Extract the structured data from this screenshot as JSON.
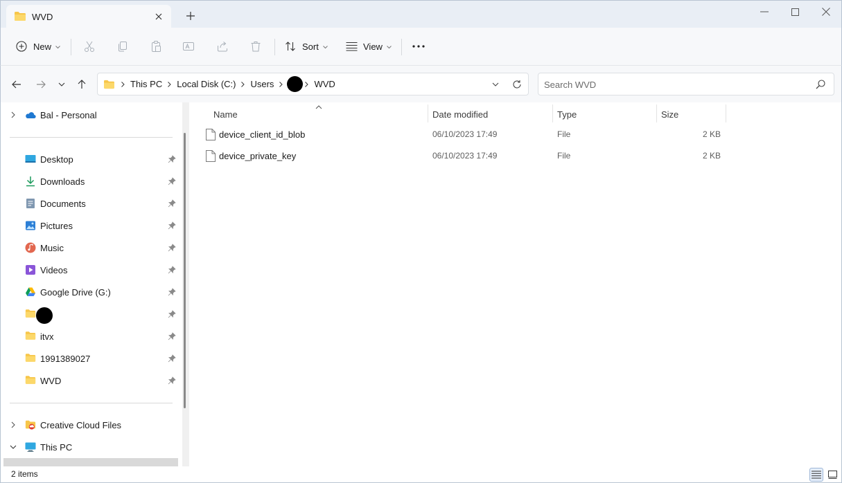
{
  "window": {
    "tab_title": "WVD",
    "minimize_icon": "minimize-icon",
    "maximize_icon": "maximize-icon",
    "close_icon": "close-icon"
  },
  "toolbar": {
    "new_label": "New",
    "sort_label": "Sort",
    "view_label": "View",
    "icons": [
      "cut-icon",
      "copy-icon",
      "paste-icon",
      "rename-icon",
      "share-icon",
      "delete-icon",
      "more-icon"
    ]
  },
  "address": {
    "crumbs": [
      "This PC",
      "Local Disk (C:)",
      "Users",
      "WVD"
    ],
    "redacted_crumb_index": 3
  },
  "search": {
    "placeholder": "Search WVD"
  },
  "sidebar": {
    "onedrive": "Bal - Personal",
    "quick_access": [
      {
        "label": "Desktop",
        "icon": "desktop-icon"
      },
      {
        "label": "Downloads",
        "icon": "download-icon"
      },
      {
        "label": "Documents",
        "icon": "documents-icon"
      },
      {
        "label": "Pictures",
        "icon": "pictures-icon"
      },
      {
        "label": "Music",
        "icon": "music-icon"
      },
      {
        "label": "Videos",
        "icon": "videos-icon"
      },
      {
        "label": "Google Drive (G:)",
        "icon": "google-drive-icon"
      },
      {
        "label": "",
        "icon": "folder-icon"
      },
      {
        "label": "itvx",
        "icon": "folder-icon"
      },
      {
        "label": "1991389027",
        "icon": "folder-icon"
      },
      {
        "label": "WVD",
        "icon": "folder-icon"
      }
    ],
    "creative_cloud": "Creative Cloud Files",
    "this_pc": "This PC"
  },
  "columns": {
    "name": "Name",
    "date": "Date modified",
    "type": "Type",
    "size": "Size"
  },
  "files": [
    {
      "name": "device_client_id_blob",
      "date": "06/10/2023 17:49",
      "type": "File",
      "size": "2 KB"
    },
    {
      "name": "device_private_key",
      "date": "06/10/2023 17:49",
      "type": "File",
      "size": "2 KB"
    }
  ],
  "status": {
    "count": "2 items"
  }
}
